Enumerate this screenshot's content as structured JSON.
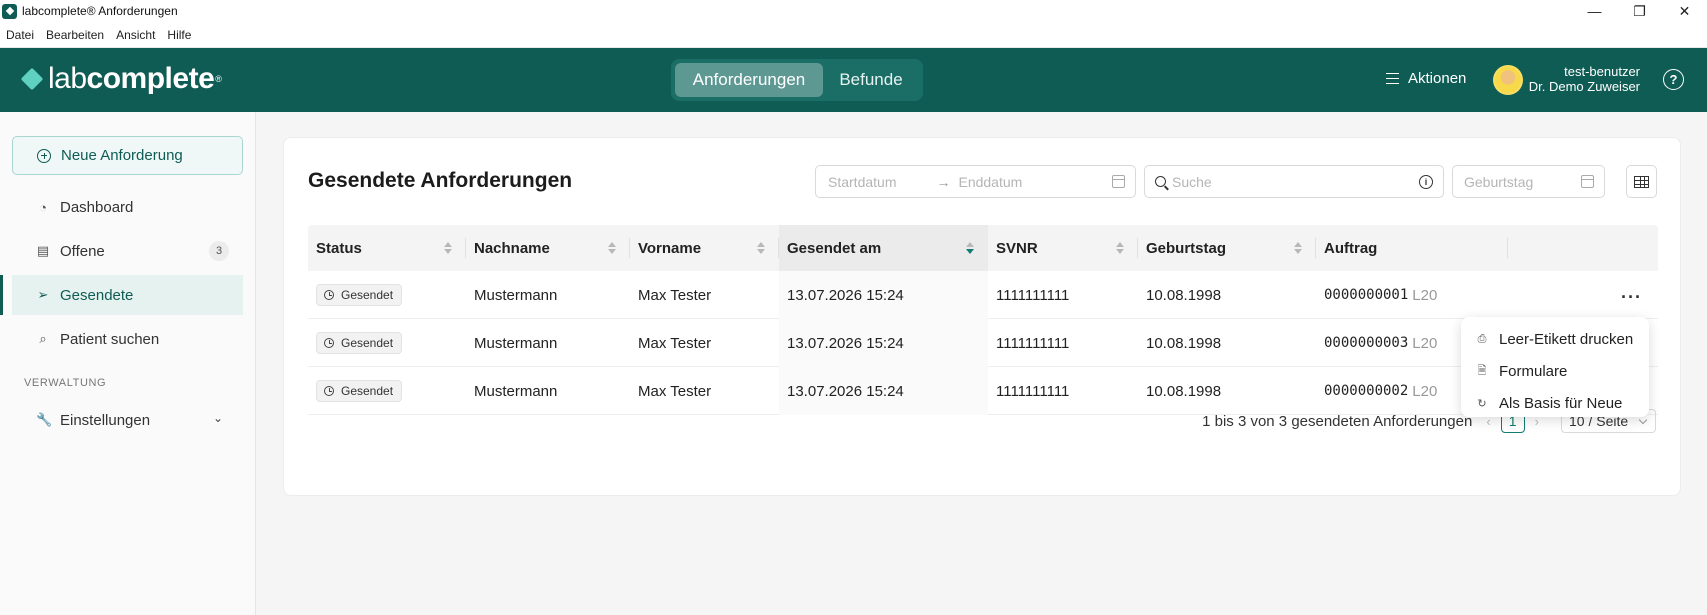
{
  "window": {
    "title": "labcomplete® Anforderungen",
    "minimize": "—",
    "restore": "❐",
    "close": "✕"
  },
  "menu": [
    "Datei",
    "Bearbeiten",
    "Ansicht",
    "Hilfe"
  ],
  "header": {
    "logo_light": "lab",
    "logo_bold": "complete",
    "logo_mark": "®",
    "tabs": [
      {
        "label": "Anforderungen",
        "active": true
      },
      {
        "label": "Befunde",
        "active": false
      }
    ],
    "actions_label": "Aktionen",
    "user_name": "test-benutzer",
    "user_org": "Dr. Demo Zuweiser",
    "help_icon": "?"
  },
  "sidebar": {
    "new_button": "Neue Anforderung",
    "items": [
      {
        "label": "Dashboard",
        "icon": "◔"
      },
      {
        "label": "Offene",
        "icon": "▤",
        "badge": "3"
      },
      {
        "label": "Gesendete",
        "icon": "➢"
      },
      {
        "label": "Patient suchen",
        "icon": "⌕"
      }
    ],
    "section_label": "VERWALTUNG",
    "settings": {
      "label": "Einstellungen",
      "icon": "🔧",
      "chevron": "⌄"
    }
  },
  "main": {
    "title": "Gesendete Anforderungen",
    "filters": {
      "start_placeholder": "Startdatum",
      "range_arrow": "→",
      "end_placeholder": "Enddatum",
      "search_placeholder": "Suche",
      "info_icon": "i",
      "birthday_placeholder": "Geburtstag"
    },
    "columns": [
      "Status",
      "Nachname",
      "Vorname",
      "Gesendet am",
      "SVNR",
      "Geburtstag",
      "Auftrag"
    ],
    "rows": [
      {
        "status": "Gesendet",
        "lastname": "Mustermann",
        "firstname": "Max Tester",
        "sent": "13.07.2026 15:24",
        "svnr": "1111111111",
        "birthday": "10.08.1998",
        "order": "0000000001",
        "order_suffix": "L20"
      },
      {
        "status": "Gesendet",
        "lastname": "Mustermann",
        "firstname": "Max Tester",
        "sent": "13.07.2026 15:24",
        "svnr": "1111111111",
        "birthday": "10.08.1998",
        "order": "0000000003",
        "order_suffix": "L20"
      },
      {
        "status": "Gesendet",
        "lastname": "Mustermann",
        "firstname": "Max Tester",
        "sent": "13.07.2026 15:24",
        "svnr": "1111111111",
        "birthday": "10.08.1998",
        "order": "0000000002",
        "order_suffix": "L20"
      }
    ],
    "more_icon": "···",
    "pagination": {
      "summary": "1 bis 3 von 3 gesendeten Anforderungen",
      "prev": "‹",
      "page": "1",
      "next": "›",
      "page_size": "10 / Seite"
    }
  },
  "context_menu": [
    {
      "label": "Leer-Etikett drucken",
      "icon": "⎙"
    },
    {
      "label": "Formulare",
      "icon": "🗎"
    },
    {
      "label": "Als Basis für Neue",
      "icon": "↻"
    }
  ],
  "colors": {
    "brand": "#0f5c55",
    "accent": "#0f7d70"
  }
}
